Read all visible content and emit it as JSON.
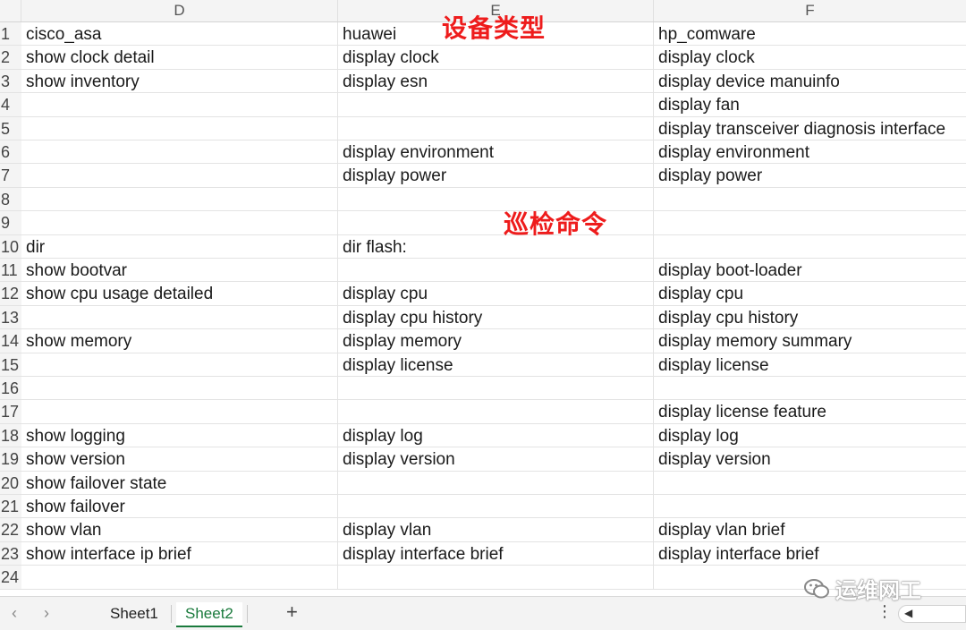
{
  "columns": [
    "D",
    "E",
    "F"
  ],
  "rows": [
    {
      "num": "1",
      "cells": [
        "cisco_asa",
        "huawei",
        "hp_comware"
      ]
    },
    {
      "num": "2",
      "cells": [
        "show clock detail",
        "display clock",
        "display clock"
      ]
    },
    {
      "num": "3",
      "cells": [
        "show inventory",
        "display esn",
        "display device manuinfo"
      ]
    },
    {
      "num": "4",
      "cells": [
        "",
        "",
        "display fan"
      ]
    },
    {
      "num": "5",
      "cells": [
        "",
        "",
        "display transceiver diagnosis interface"
      ]
    },
    {
      "num": "6",
      "cells": [
        "",
        "display environment",
        "display environment"
      ]
    },
    {
      "num": "7",
      "cells": [
        "",
        "display power",
        "display power"
      ]
    },
    {
      "num": "8",
      "cells": [
        "",
        "",
        ""
      ]
    },
    {
      "num": "9",
      "cells": [
        "",
        "",
        ""
      ]
    },
    {
      "num": "10",
      "cells": [
        "dir",
        "dir flash:",
        ""
      ]
    },
    {
      "num": "11",
      "cells": [
        "show bootvar",
        "",
        "display boot-loader"
      ]
    },
    {
      "num": "12",
      "cells": [
        "show cpu usage detailed",
        "display cpu",
        "display cpu"
      ]
    },
    {
      "num": "13",
      "cells": [
        "",
        "display cpu history",
        "display cpu history"
      ]
    },
    {
      "num": "14",
      "cells": [
        "show memory",
        "display memory",
        "display memory summary"
      ]
    },
    {
      "num": "15",
      "cells": [
        "",
        "display license",
        "display license"
      ]
    },
    {
      "num": "16",
      "cells": [
        "",
        "",
        ""
      ]
    },
    {
      "num": "17",
      "cells": [
        "",
        "",
        "display license feature"
      ]
    },
    {
      "num": "18",
      "cells": [
        "show logging",
        "display log",
        "display log"
      ]
    },
    {
      "num": "19",
      "cells": [
        "show version",
        "display version",
        "display version"
      ]
    },
    {
      "num": "20",
      "cells": [
        "show failover state",
        "",
        ""
      ]
    },
    {
      "num": "21",
      "cells": [
        "show failover",
        "",
        ""
      ]
    },
    {
      "num": "22",
      "cells": [
        "show vlan",
        "display vlan",
        "display vlan brief"
      ]
    },
    {
      "num": "23",
      "cells": [
        "show interface ip brief",
        "display interface brief",
        "display interface brief"
      ]
    },
    {
      "num": "24",
      "cells": [
        "",
        "",
        ""
      ]
    }
  ],
  "overlay": {
    "device_type": "设备类型",
    "inspect_cmds": "巡检命令",
    "color": "#ee1c1c"
  },
  "tabs": {
    "prev_icon": "‹",
    "next_icon": "›",
    "items": [
      "Sheet1",
      "Sheet2"
    ],
    "active": "Sheet2",
    "add_label": "+",
    "more_icon": "⋮"
  },
  "watermark": {
    "text": "运维网工",
    "icon": "wechat-icon"
  }
}
